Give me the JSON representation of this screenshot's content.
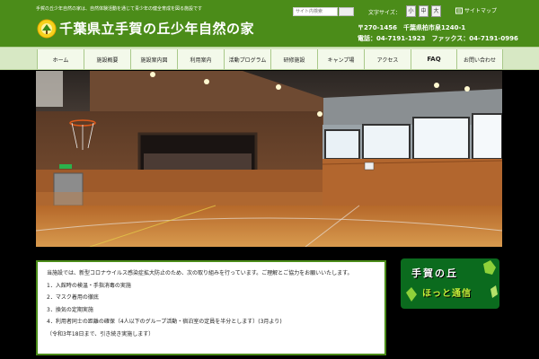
{
  "header": {
    "tagline": "手賀の丘少年自然の家は、自然体験活動を通じて青少年の健全育成を図る施設です",
    "title": "千葉県立手賀の丘少年自然の家",
    "search_placeholder": "サイト内検索",
    "fontsize_label": "文字サイズ：",
    "fontsize_options": [
      "小",
      "中",
      "大"
    ],
    "sitemap_label": "サイトマップ",
    "address": "〒270-1456　千葉県柏市泉1240-1",
    "tel_fax": "電話：04-7191-1923　ファックス：04-7191-0996"
  },
  "nav": {
    "items": [
      "ホーム",
      "施設概要",
      "施設案内図",
      "利用案内",
      "活動プログラム",
      "研修施設",
      "キャンプ場",
      "アクセス",
      "FAQ",
      "お問い合わせ"
    ]
  },
  "notice": {
    "lines": [
      "当施設では、新型コロナウイルス感染症拡大防止のため、次の取り組みを行っています。ご理解とご協力をお願いいたします。",
      "1．入館時の検温・手指消毒の実施",
      "2．マスク着用の徹底",
      "3．換気の定期実施",
      "4．利用者同士の距離の確保（4人以下のグループ活動・宿泊室の定員を半分とします）(3月より)",
      "（令和3年18日まで、引き続き実施します）"
    ]
  },
  "banner": {
    "line1": "手賀の丘",
    "line2": "ほっと通信"
  },
  "colors": {
    "header_green": "#4b8c19",
    "nav_bg": "#d7e8c4",
    "banner_green": "#0b6b1e",
    "banner_accent": "#c6f03a"
  }
}
